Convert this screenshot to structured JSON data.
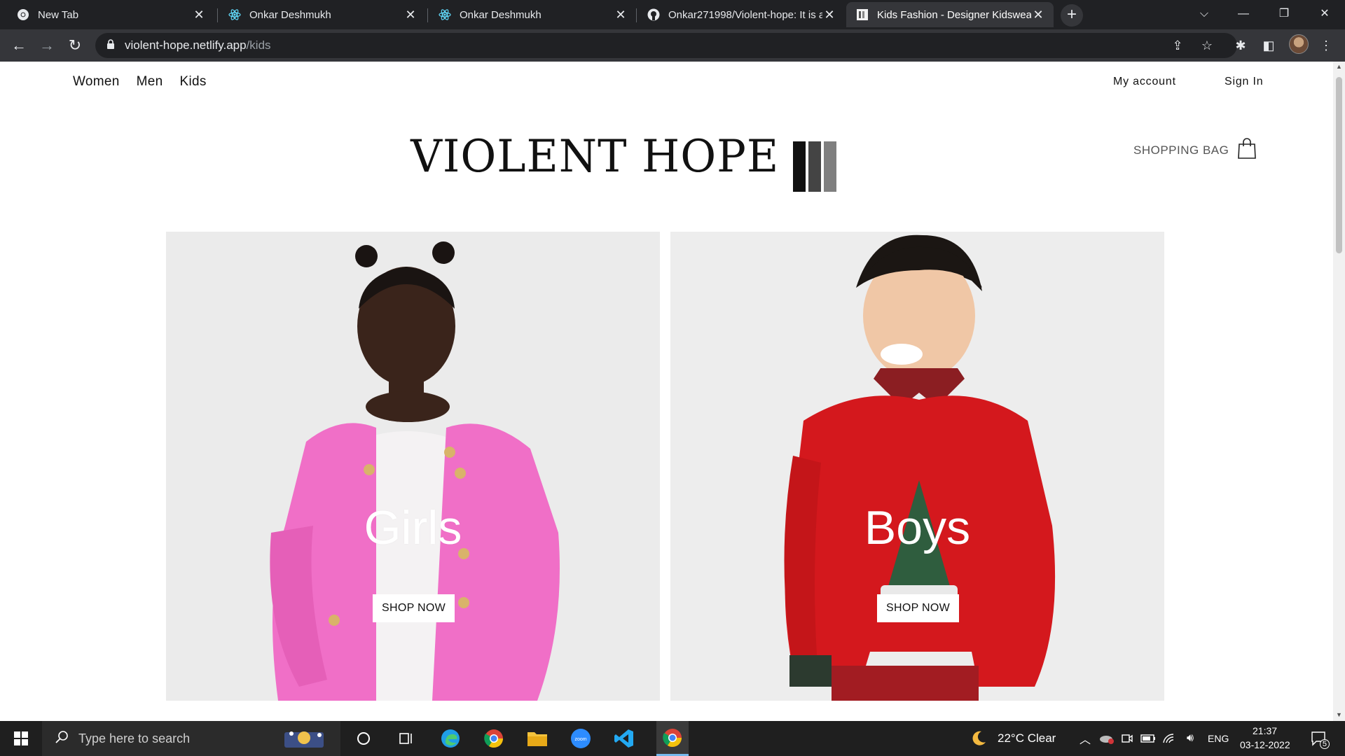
{
  "browser": {
    "tabs": [
      {
        "title": "New Tab",
        "icon": "chrome-icon"
      },
      {
        "title": "Onkar Deshmukh",
        "icon": "react-icon"
      },
      {
        "title": "Onkar Deshmukh",
        "icon": "react-icon"
      },
      {
        "title": "Onkar271998/Violent-hope: It is a",
        "icon": "github-icon"
      },
      {
        "title": "Kids Fashion - Designer Kidswear",
        "icon": "site-icon"
      }
    ],
    "new_tab": "+",
    "url_host": "violent-hope.netlify.app",
    "url_path": "/kids"
  },
  "nav": {
    "left": [
      "Women",
      "Men",
      "Kids"
    ],
    "my_account": "My account",
    "sign_in": "Sign In"
  },
  "logo": {
    "text": "VIOLENT HOPE",
    "bar_colors": [
      "#111111",
      "#444444",
      "#7f7f7f"
    ]
  },
  "bag": {
    "label": "SHOPPING BAG"
  },
  "cards": [
    {
      "label": "Girls",
      "button": "SHOP NOW"
    },
    {
      "label": "Boys",
      "button": "SHOP NOW"
    }
  ],
  "taskbar": {
    "search_placeholder": "Type here to search",
    "weather": "22°C  Clear",
    "lang": "ENG",
    "time": "21:37",
    "date": "03-12-2022",
    "notifications": "5"
  },
  "colors": {
    "girls_jacket": "#f06fc7",
    "boys_sweater": "#d4181d"
  }
}
